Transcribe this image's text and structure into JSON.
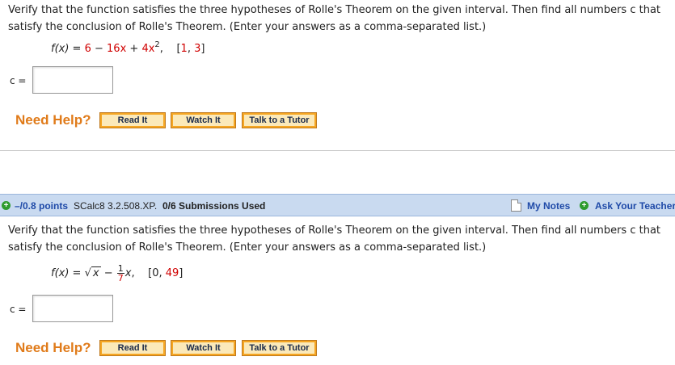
{
  "problem1": {
    "text": "Verify that the function satisfies the three hypotheses of Rolle's Theorem on the given interval. Then find all numbers c that satisfy the conclusion of Rolle's Theorem. (Enter your answers as a comma-separated list.)",
    "formula_lhs": "f(x) = ",
    "term1": "6",
    "minus": " − ",
    "term2": "16x",
    "plus": " + ",
    "term3": "4x",
    "exp": "2",
    "comma": ",",
    "interval": "[1, 3]",
    "c_label": "c =",
    "answer_value": ""
  },
  "help": {
    "title": "Need Help?",
    "read_it": "Read It",
    "watch_it": "Watch It",
    "tutor": "Talk to a Tutor"
  },
  "question2_header": {
    "points": "–/0.8 points",
    "code": "SCalc8 3.2.508.XP.",
    "submissions": "0/6 Submissions Used",
    "my_notes": "My Notes",
    "ask_teacher": "Ask Your Teacher"
  },
  "problem2": {
    "text": "Verify that the function satisfies the three hypotheses of Rolle's Theorem on the given interval. Then find all numbers c that satisfy the conclusion of Rolle's Theorem. (Enter your answers as a comma-separated list.)",
    "formula_lhs": "f(x) = ",
    "sqrt_arg": "x",
    "minus": " − ",
    "frac_num": "1",
    "frac_den": "7",
    "x_var": "x",
    "comma": ",",
    "interval": "[0, 49]",
    "c_label": "c =",
    "answer_value": ""
  },
  "colors": {
    "accent_orange": "#e07b1a",
    "header_blue": "#c9daf0",
    "link_blue": "#1f4aa8",
    "highlight_red": "#d00000"
  }
}
